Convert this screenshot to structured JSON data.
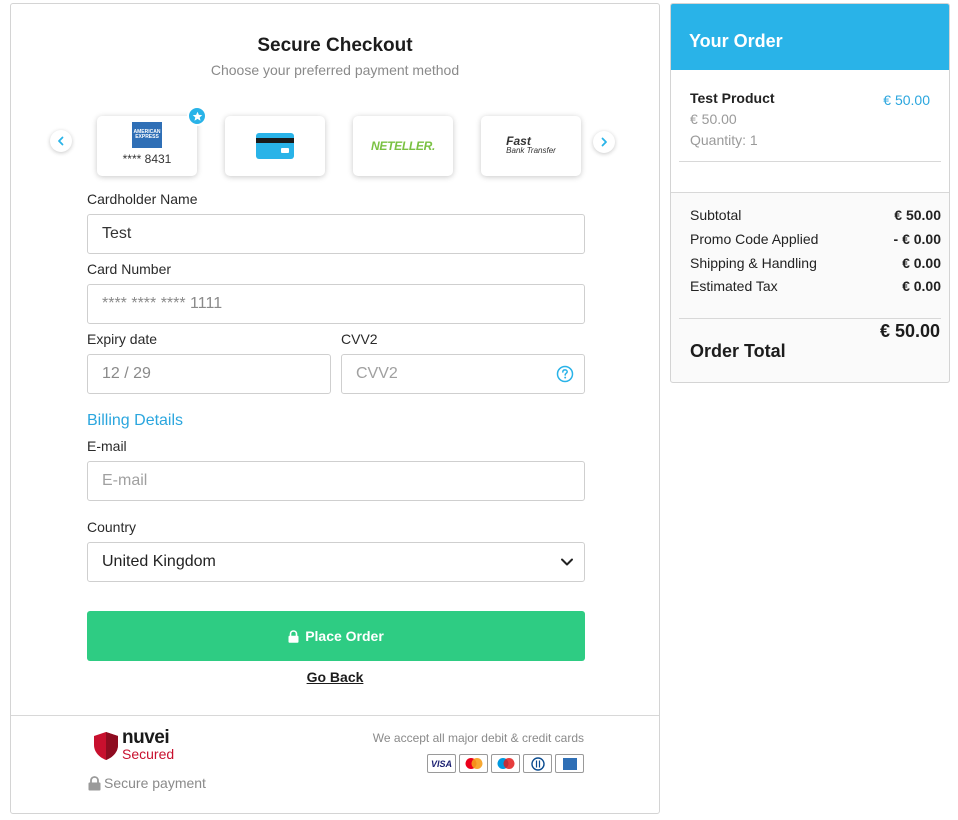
{
  "checkout": {
    "title": "Secure Checkout",
    "subtitle": "Choose your preferred payment method",
    "payment_methods": {
      "amex": {
        "logo_text": "AMERICAN EXPRESS",
        "masked_number": "**** 8431"
      },
      "card": {
        "icon": "credit-card-icon"
      },
      "neteller": {
        "logo_text": "NETELLER."
      },
      "fast_bank_transfer": {
        "logo_top": "Fast",
        "logo_bottom": "Bank Transfer"
      }
    },
    "cardholder": {
      "label": "Cardholder Name",
      "value": "Test"
    },
    "card_number": {
      "label": "Card Number",
      "value": "**** **** **** 1111"
    },
    "expiry": {
      "label": "Expiry date",
      "value": "12 / 29"
    },
    "cvv": {
      "label": "CVV2",
      "placeholder": "CVV2"
    },
    "billing_heading": "Billing Details",
    "email": {
      "label": "E-mail",
      "placeholder": "E-mail"
    },
    "country": {
      "label": "Country",
      "value": "United Kingdom"
    },
    "place_order_label": "Place Order",
    "go_back_label": "Go Back",
    "footer": {
      "brand": "nuvei",
      "brand_secured": "Secured",
      "secure_payment": "Secure payment",
      "accept_text": "We accept all major debit & credit cards",
      "card_logos": [
        "VISA",
        "Mastercard",
        "Maestro",
        "Diners Club",
        "American Express"
      ]
    }
  },
  "order": {
    "title": "Your Order",
    "product": {
      "name": "Test Product",
      "price": "€ 50.00",
      "price_right": "€ 50.00",
      "quantity": "Quantity: 1"
    },
    "summary": [
      {
        "label": "Subtotal",
        "value": "€ 50.00"
      },
      {
        "label": "Promo Code Applied",
        "value": "- € 0.00"
      },
      {
        "label": "Shipping & Handling",
        "value": "€ 0.00"
      },
      {
        "label": "Estimated Tax",
        "value": "€ 0.00"
      }
    ],
    "total_label": "Order Total",
    "total_value": "€ 50.00"
  },
  "colors": {
    "accent": "#29b3e8",
    "button": "#2ecc83",
    "brand_red": "#c8102e"
  }
}
